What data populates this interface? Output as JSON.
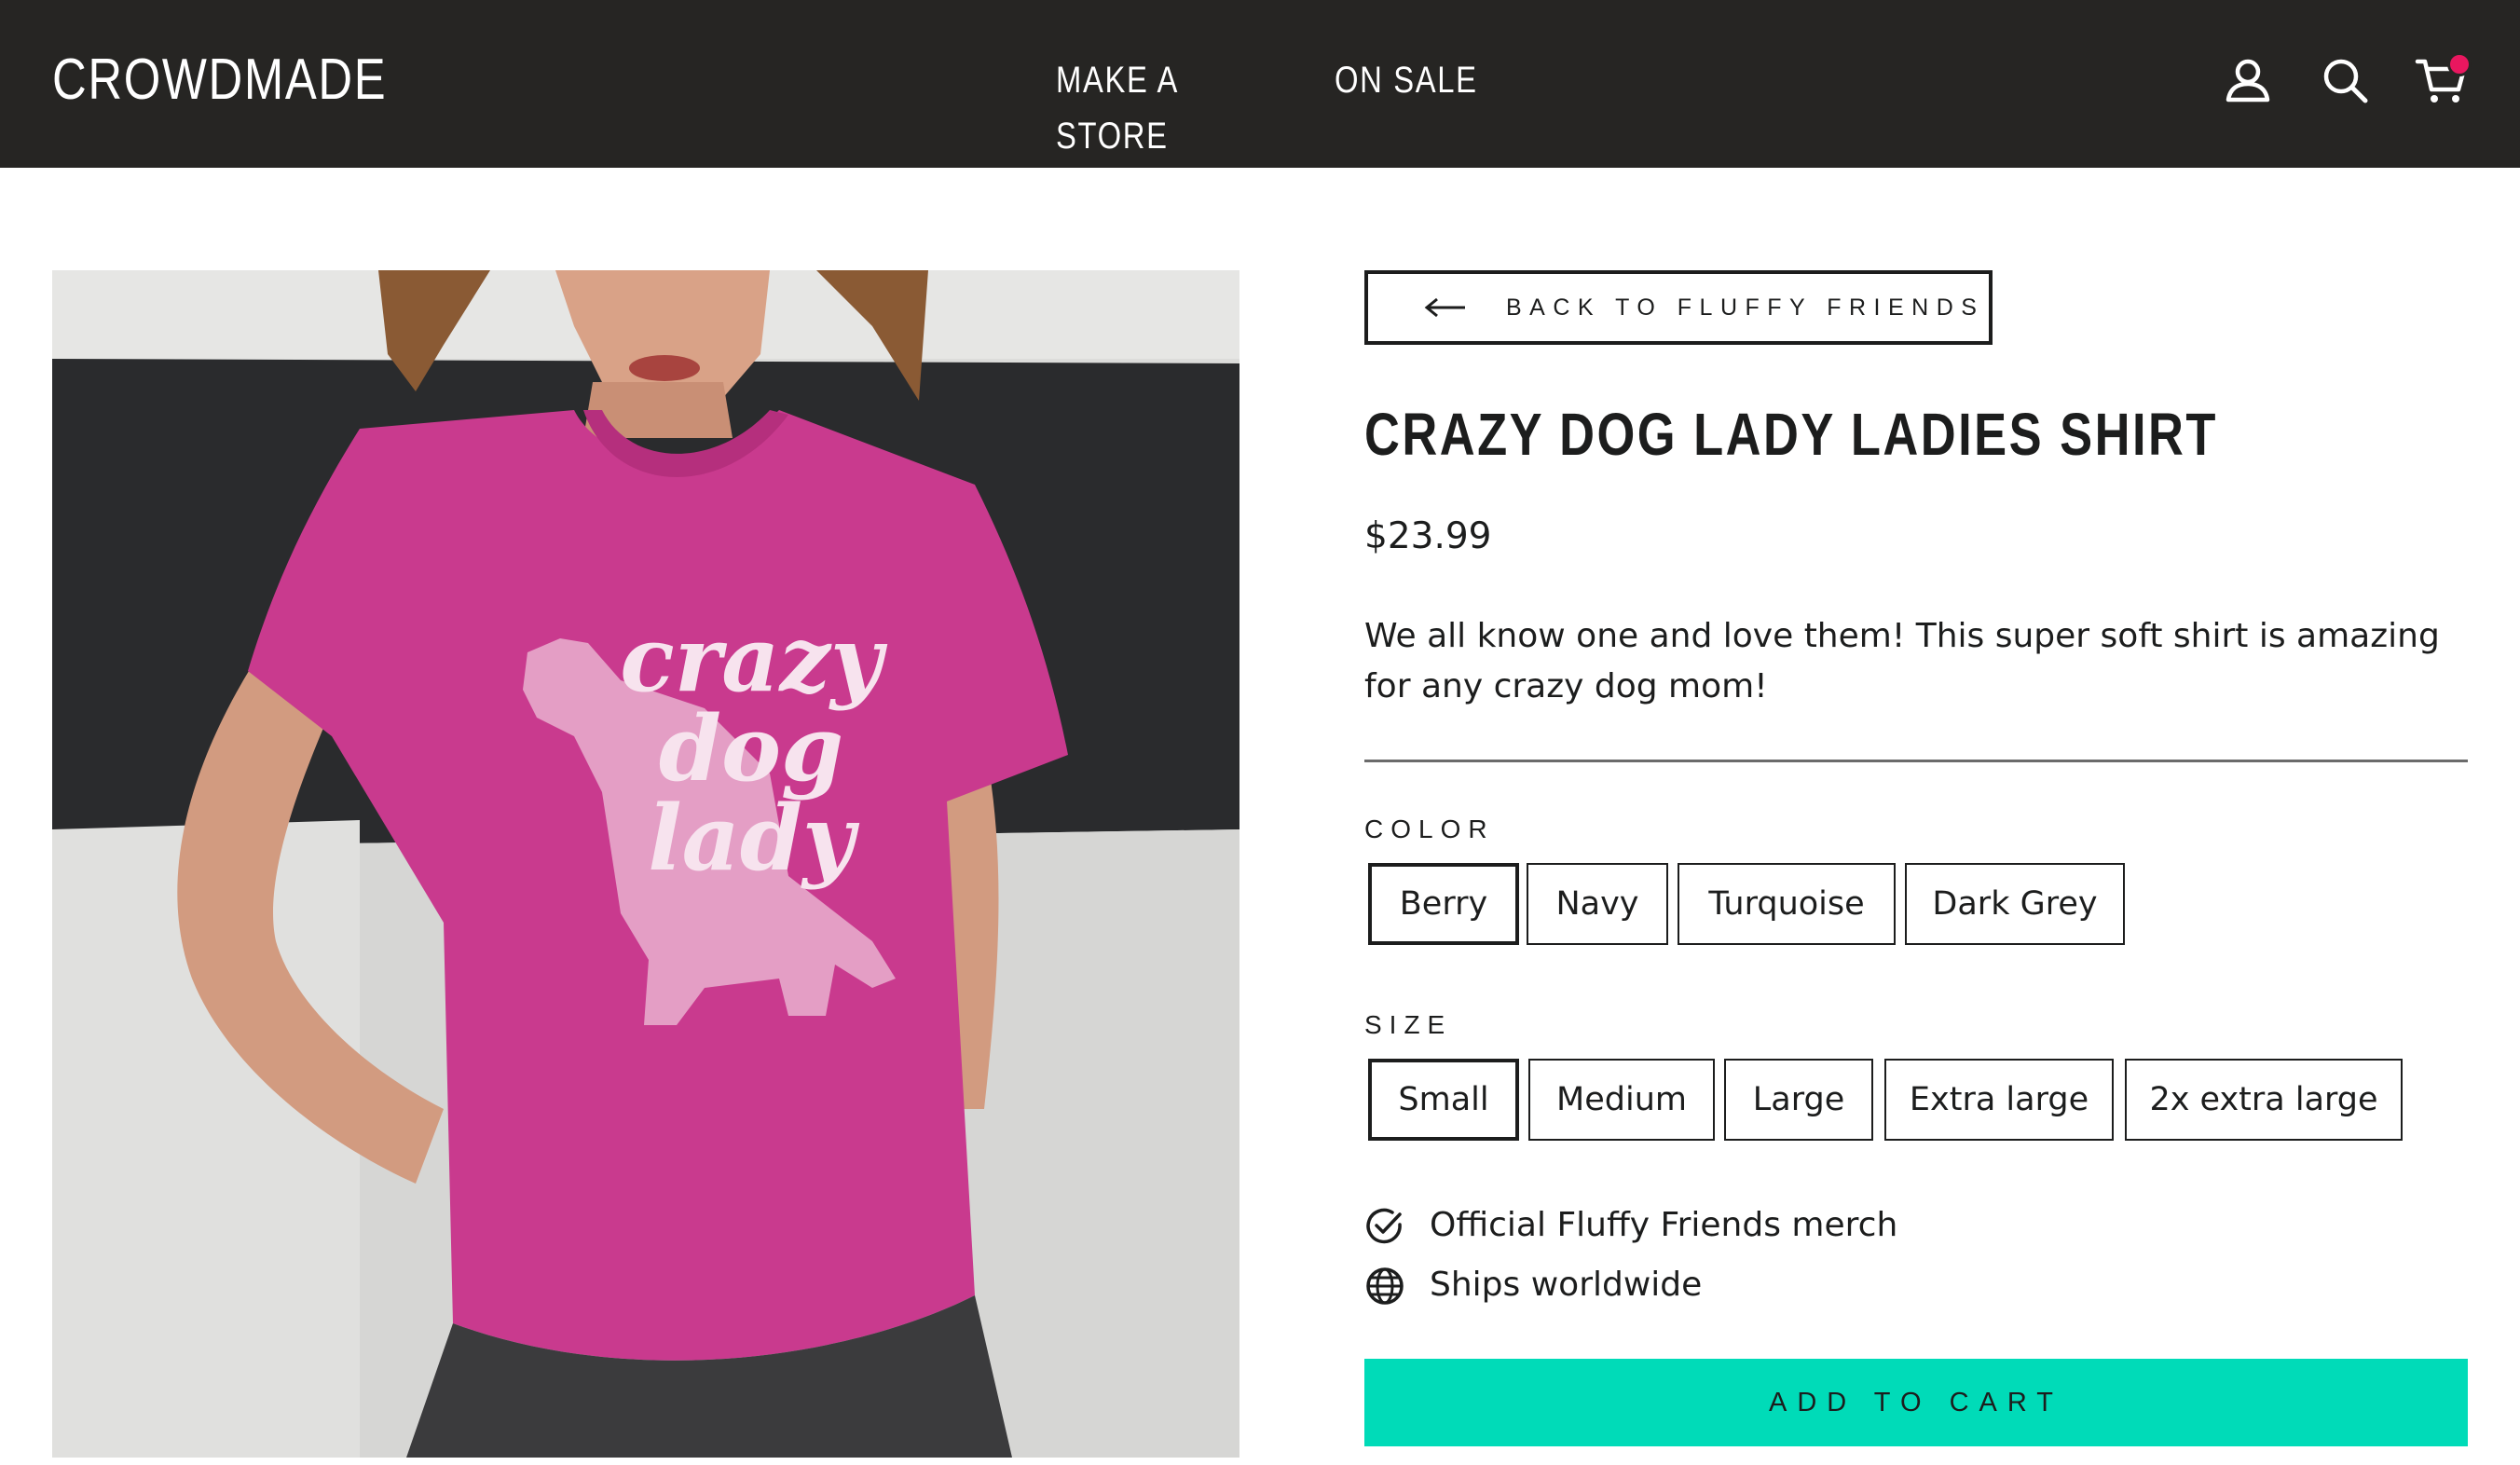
{
  "header": {
    "logo": "CROWDMADE",
    "nav": [
      {
        "label": "MAKE A STORE"
      },
      {
        "label": "ON SALE"
      }
    ],
    "icons": [
      "account-icon",
      "search-icon",
      "cart-icon"
    ]
  },
  "product": {
    "image_alt": "Woman wearing a berry t-shirt printed with a dog silhouette and the words crazy dog lady",
    "shirt_print": [
      "crazy",
      "dog",
      "lady"
    ],
    "back_link": "BACK TO FLUFFY FRIENDS",
    "title": "CRAZY DOG LADY LADIES SHIRT",
    "price": "$23.99",
    "description": "We all know one and love them! This super soft shirt is amazing for any crazy dog mom!",
    "color": {
      "label": "COLOR",
      "selected": "Berry",
      "options": [
        "Berry",
        "Navy",
        "Turquoise",
        "Dark Grey"
      ]
    },
    "size": {
      "label": "SIZE",
      "selected": "Small",
      "options": [
        "Small",
        "Medium",
        "Large",
        "Extra large",
        "2x extra large"
      ]
    },
    "features": [
      {
        "icon": "check-circle-icon",
        "text": "Official Fluffy Friends merch"
      },
      {
        "icon": "globe-icon",
        "text": "Ships worldwide"
      }
    ],
    "add_to_cart": "ADD TO CART"
  },
  "colors": {
    "header_bg": "#262523",
    "cart_badge": "#e9175f",
    "add_to_cart_bg": "#00dbb8",
    "shirt": "#c93a8e"
  }
}
